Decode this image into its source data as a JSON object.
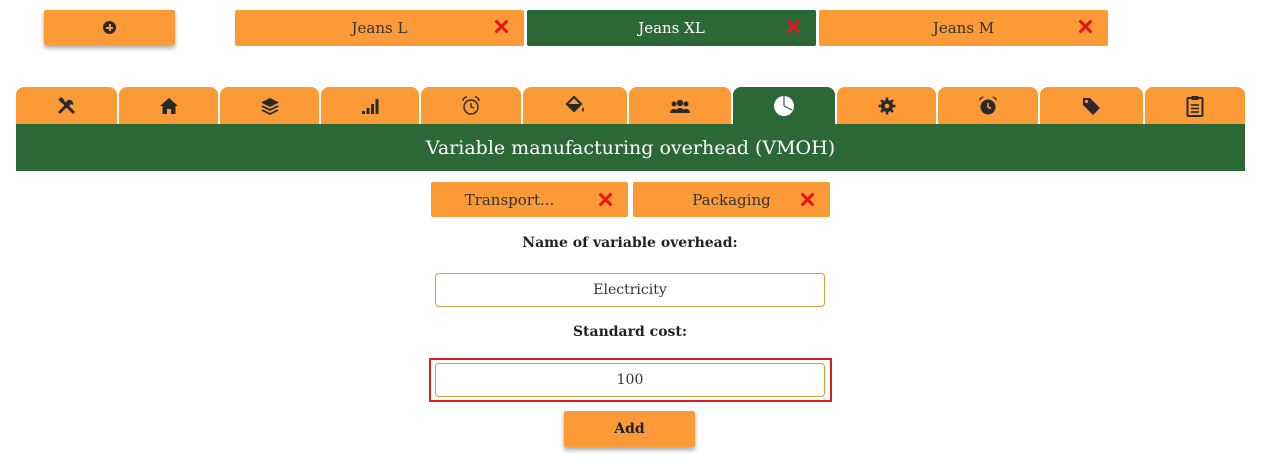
{
  "top": {
    "add_icon": "plus-circle-icon"
  },
  "product_tabs": [
    {
      "label": "Jeans L",
      "active": false
    },
    {
      "label": "Jeans XL",
      "active": true
    },
    {
      "label": "Jeans M",
      "active": false
    }
  ],
  "section_tabs": [
    {
      "icon": "tools-icon"
    },
    {
      "icon": "home-icon"
    },
    {
      "icon": "layers-icon"
    },
    {
      "icon": "signal-bars-icon"
    },
    {
      "icon": "alarm-clock-outline-icon"
    },
    {
      "icon": "paint-bucket-icon"
    },
    {
      "icon": "users-icon"
    },
    {
      "icon": "pie-chart-icon",
      "active": true
    },
    {
      "icon": "cog-icon"
    },
    {
      "icon": "alarm-clock-icon"
    },
    {
      "icon": "tags-icon"
    },
    {
      "icon": "clipboard-icon"
    }
  ],
  "header": {
    "title": "Variable manufacturing overhead (VMOH)"
  },
  "overhead_tabs": [
    {
      "label": "Transport..."
    },
    {
      "label": "Packaging"
    }
  ],
  "form": {
    "name_label": "Name of variable overhead:",
    "name_value": "Electricity",
    "cost_label": "Standard cost:",
    "cost_value": "100",
    "submit_label": "Add"
  },
  "colors": {
    "accent": "#fb9a37",
    "brand_green": "#2c6738",
    "delete_red": "#e8141a",
    "highlight_red": "#d61f1f"
  }
}
